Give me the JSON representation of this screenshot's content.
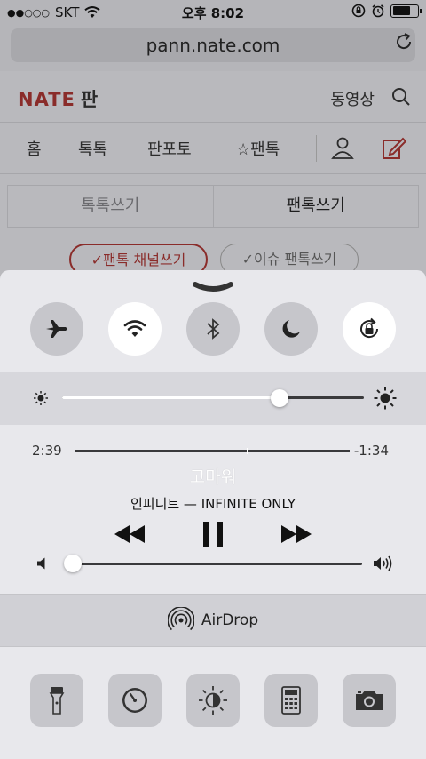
{
  "status_bar": {
    "signal_dots": "●●○○○",
    "carrier": "SKT",
    "time": "오후 8:02",
    "battery_level": 0.75
  },
  "browser": {
    "url": "pann.nate.com"
  },
  "page": {
    "logo": "NATE",
    "logo_suffix": "판",
    "video_link": "동영상",
    "nav": [
      "홈",
      "톡톡",
      "판포토",
      "☆팬톡"
    ],
    "tabs": [
      "톡톡쓰기",
      "팬톡쓰기"
    ],
    "pills": [
      "✓팬톡 채널쓰기",
      "✓이슈 팬톡쓰기"
    ]
  },
  "control_center": {
    "toggles": [
      {
        "name": "airplane-mode",
        "on": false
      },
      {
        "name": "wifi",
        "on": true
      },
      {
        "name": "bluetooth",
        "on": false
      },
      {
        "name": "do-not-disturb",
        "on": false
      },
      {
        "name": "rotation-lock",
        "on": true
      }
    ],
    "brightness_level": 0.72,
    "music": {
      "elapsed": "2:39",
      "remaining": "-1:34",
      "progress": 0.63,
      "song": "고마워",
      "artist_album": "인피니트 — INFINITE ONLY"
    },
    "volume_level": 0.0,
    "airdrop_label": "AirDrop",
    "tools": [
      "flashlight-icon",
      "timer-icon",
      "night-shift-icon",
      "calculator-icon",
      "camera-icon"
    ]
  },
  "colors": {
    "nate_red": "#8a2c2a",
    "cc_background": "#e8e8ec",
    "toggle_on": "#ffffff",
    "toggle_off": "#c6c6cb"
  }
}
